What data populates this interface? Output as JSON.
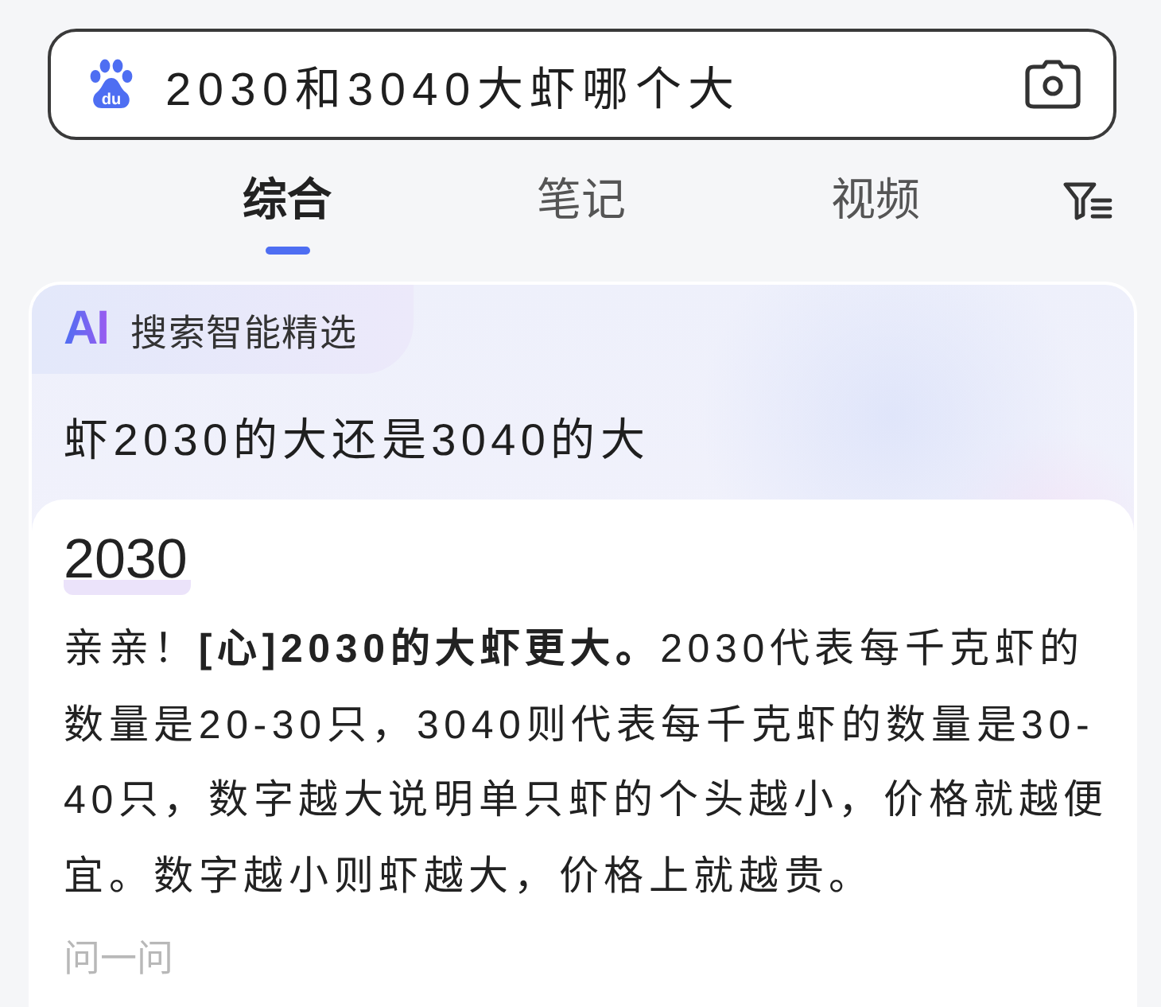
{
  "search": {
    "logo_text": "du",
    "value": "2030和3040大虾哪个大"
  },
  "tabs": [
    {
      "label": "综合",
      "selected": true
    },
    {
      "label": "笔记",
      "selected": false
    },
    {
      "label": "视频",
      "selected": false
    }
  ],
  "ai_card": {
    "logo": "AI",
    "badge": "搜索智能精选",
    "question": "虾2030的大还是3040的大",
    "answer": {
      "heading": "2030",
      "text": "亲亲！**[心]2030的大虾更大。**2030代表每千克虾的数量是20-30只，3040则代表每千克虾的数量是30-40只，数字越大说明单只虾的个头越小，价格就越便宜。数字越小则虾越大，价格上就越贵。",
      "action": "问一问"
    }
  }
}
